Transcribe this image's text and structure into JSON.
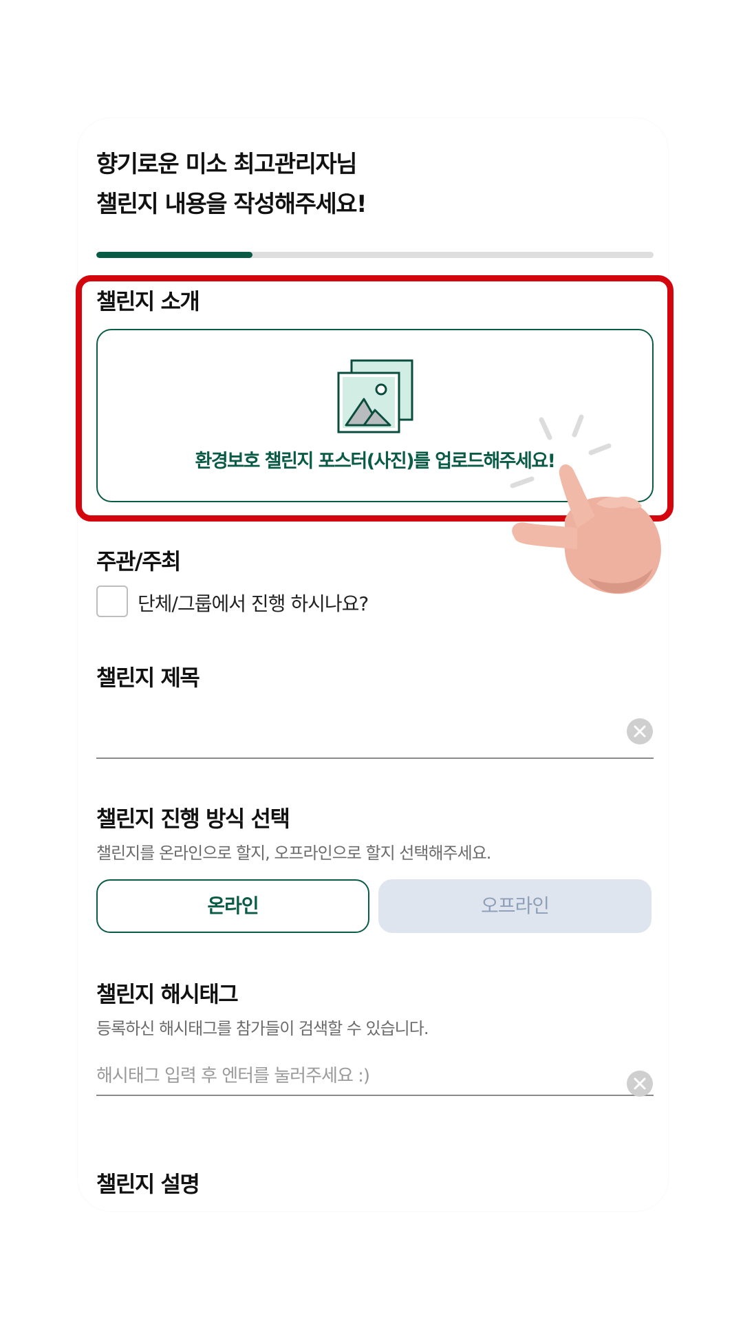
{
  "header": {
    "line1": "향기로운 미소 최고관리자님",
    "line2": "챌린지 내용을 작성해주세요!"
  },
  "progress": {
    "value": 0.28,
    "fill_color": "#0a5b46"
  },
  "intro": {
    "title": "챌린지 소개",
    "upload_text": "환경보호 챌린지 포스터(사진)를 업로드해주세요!",
    "highlight_color": "#d3060e"
  },
  "host": {
    "title": "주관/주최",
    "checkbox_label": "단체/그룹에서 진행 하시나요?",
    "checked": false
  },
  "challenge_title": {
    "title": "챌린지 제목",
    "value": "",
    "placeholder": ""
  },
  "method": {
    "title": "챌린지 진행 방식 선택",
    "description": "챌린지를 온라인으로 할지, 오프라인으로 할지 선택해주세요.",
    "online_label": "온라인",
    "offline_label": "오프라인",
    "selected": "온라인"
  },
  "hashtag": {
    "title": "챌린지 해시태그",
    "description": "등록하신 해시태그를 참가들이 검색할 수 있습니다.",
    "placeholder": "해시태그 입력 후 엔터를 눌러주세요 :)"
  },
  "description_section": {
    "title": "챌린지 설명"
  },
  "icons": {
    "upload": "image-gallery-icon",
    "clear": "clear-icon",
    "pointer": "pointing-hand-icon"
  }
}
